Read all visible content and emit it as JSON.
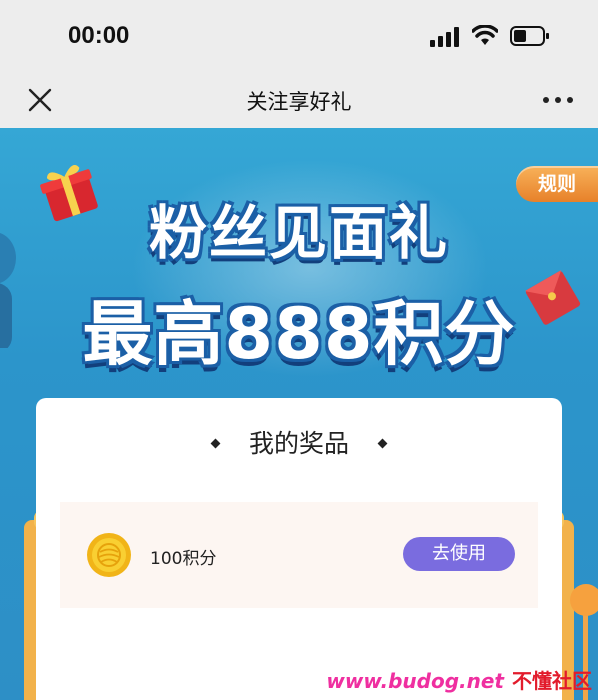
{
  "status_bar": {
    "time": "00:00"
  },
  "nav": {
    "title": "关注享好礼"
  },
  "banner": {
    "rules_label": "规则",
    "headline_1": "粉丝见面礼",
    "headline_2": "最高888积分"
  },
  "card": {
    "title": "我的奖品",
    "prize": {
      "name": "100积分",
      "button_label": "去使用"
    }
  },
  "watermark": {
    "url": "www.budog.net",
    "name": "不懂社区"
  },
  "colors": {
    "button": "#7a6cdf",
    "banner": "#2f9bd0",
    "rules": "#e7812a",
    "prize_bg": "#fdf6f2"
  }
}
